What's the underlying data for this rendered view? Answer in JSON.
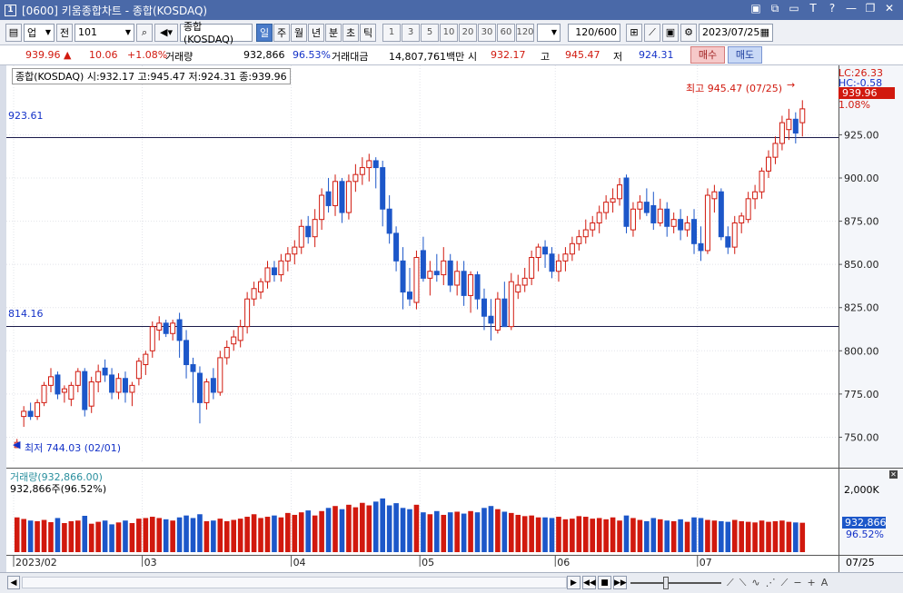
{
  "window": {
    "badge": "1",
    "title": "[0600] 키움종합차트 - 종합(KOSDAQ)",
    "icons": [
      "layout-icon",
      "copy-icon",
      "window-icon",
      "font-icon",
      "help-icon",
      "minimize-icon",
      "restore-icon",
      "close-icon"
    ]
  },
  "toolbar": {
    "market": "업",
    "market2": "전",
    "code": "101",
    "name": "종합(KOSDAQ)",
    "periods": [
      "일",
      "주",
      "월",
      "년",
      "분",
      "초",
      "틱"
    ],
    "selected_period": "일",
    "intervals": [
      "1",
      "3",
      "5",
      "10",
      "20",
      "30",
      "60",
      "120"
    ],
    "count": "120",
    "count_max": "/600",
    "date": "2023/07/25"
  },
  "quote": {
    "price": "939.96",
    "arrow": "▲",
    "change": "10.06",
    "change_pct": "+1.08%",
    "volume_label": "거래량",
    "volume": "932,866",
    "volume_pct": "96.53%",
    "amount_label": "거래대금",
    "amount": "14,807,761백만",
    "open_label": "시",
    "open": "932.17",
    "high_label": "고",
    "high": "945.47",
    "low_label": "저",
    "low": "924.31",
    "buy": "매수",
    "sell": "매도"
  },
  "chart_labels": {
    "price_info": "종합(KOSDAQ) 시:932.17 고:945.47 저:924.31 종:939.96",
    "lc": "LC:26.33",
    "hc": "HC:-0.58",
    "last_price": "939.96",
    "last_pct": "1.08%",
    "high_note": "최고 945.47 (07/25)",
    "low_note": "최저 744.03 (02/01)",
    "line_upper": "923.61",
    "line_lower": "814.16",
    "volume_title": "거래량(932,866.00)",
    "volume_sub": "932,866주(96.52%)",
    "volume_axis_top": "2,000K",
    "volume_last": "932,866",
    "volume_last_pct": "96.52%",
    "x_last": "07/25"
  },
  "colors": {
    "up": "#d1190e",
    "down": "#1c57c9",
    "accent": "#4a69a8"
  },
  "chart_data": {
    "type": "candlestick",
    "ylim": [
      735,
      962
    ],
    "yticks": [
      "925.00",
      "900.00",
      "875.00",
      "850.00",
      "825.00",
      "800.00",
      "775.00",
      "750.00"
    ],
    "ytick_values": [
      925,
      900,
      875,
      850,
      825,
      800,
      775,
      750
    ],
    "h_lines": [
      923.61,
      814.16
    ],
    "months": [
      {
        "label": "2023/02",
        "index": 0
      },
      {
        "label": "03",
        "index": 19
      },
      {
        "label": "04",
        "index": 41
      },
      {
        "label": "05",
        "index": 60
      },
      {
        "label": "06",
        "index": 80
      },
      {
        "label": "07",
        "index": 101
      }
    ],
    "volume_ylim": [
      0,
      2300
    ],
    "ohlc": [
      [
        744,
        749,
        744,
        747
      ],
      [
        762,
        768,
        756,
        765
      ],
      [
        765,
        770,
        760,
        762
      ],
      [
        762,
        772,
        760,
        770
      ],
      [
        770,
        782,
        768,
        780
      ],
      [
        780,
        790,
        776,
        785
      ],
      [
        786,
        788,
        772,
        775
      ],
      [
        776,
        780,
        770,
        778
      ],
      [
        772,
        782,
        768,
        780
      ],
      [
        780,
        790,
        776,
        788
      ],
      [
        788,
        790,
        762,
        766
      ],
      [
        768,
        785,
        764,
        782
      ],
      [
        782,
        792,
        776,
        788
      ],
      [
        790,
        795,
        782,
        786
      ],
      [
        786,
        790,
        772,
        776
      ],
      [
        776,
        787,
        772,
        784
      ],
      [
        784,
        788,
        770,
        776
      ],
      [
        776,
        782,
        768,
        780
      ],
      [
        784,
        796,
        780,
        794
      ],
      [
        792,
        800,
        786,
        798
      ],
      [
        800,
        817,
        796,
        814
      ],
      [
        812,
        820,
        806,
        816
      ],
      [
        816,
        818,
        808,
        810
      ],
      [
        810,
        818,
        806,
        816
      ],
      [
        818,
        822,
        796,
        806
      ],
      [
        806,
        812,
        784,
        792
      ],
      [
        792,
        796,
        770,
        788
      ],
      [
        787,
        791,
        758,
        770
      ],
      [
        770,
        784,
        766,
        782
      ],
      [
        784,
        790,
        772,
        776
      ],
      [
        776,
        800,
        774,
        796
      ],
      [
        796,
        806,
        792,
        802
      ],
      [
        804,
        812,
        800,
        808
      ],
      [
        806,
        818,
        802,
        814
      ],
      [
        814,
        834,
        810,
        830
      ],
      [
        830,
        840,
        826,
        836
      ],
      [
        834,
        842,
        830,
        840
      ],
      [
        840,
        852,
        836,
        848
      ],
      [
        848,
        852,
        840,
        844
      ],
      [
        844,
        856,
        840,
        852
      ],
      [
        852,
        860,
        846,
        856
      ],
      [
        856,
        864,
        850,
        860
      ],
      [
        860,
        876,
        856,
        872
      ],
      [
        872,
        878,
        862,
        866
      ],
      [
        866,
        882,
        860,
        876
      ],
      [
        876,
        894,
        870,
        890
      ],
      [
        892,
        900,
        880,
        884
      ],
      [
        884,
        902,
        878,
        898
      ],
      [
        898,
        900,
        874,
        880
      ],
      [
        880,
        902,
        876,
        898
      ],
      [
        898,
        908,
        892,
        902
      ],
      [
        902,
        912,
        896,
        906
      ],
      [
        906,
        914,
        898,
        910
      ],
      [
        910,
        912,
        894,
        906
      ],
      [
        906,
        910,
        872,
        882
      ],
      [
        882,
        890,
        862,
        868
      ],
      [
        868,
        872,
        846,
        852
      ],
      [
        852,
        860,
        824,
        834
      ],
      [
        834,
        848,
        826,
        830
      ],
      [
        828,
        858,
        824,
        854
      ],
      [
        858,
        866,
        840,
        842
      ],
      [
        842,
        852,
        832,
        846
      ],
      [
        846,
        856,
        840,
        844
      ],
      [
        844,
        860,
        838,
        852
      ],
      [
        852,
        856,
        834,
        838
      ],
      [
        838,
        852,
        832,
        846
      ],
      [
        846,
        852,
        826,
        832
      ],
      [
        832,
        846,
        822,
        844
      ],
      [
        844,
        846,
        824,
        830
      ],
      [
        830,
        836,
        812,
        820
      ],
      [
        820,
        830,
        806,
        816
      ],
      [
        812,
        834,
        810,
        830
      ],
      [
        830,
        840,
        820,
        814
      ],
      [
        814,
        845,
        812,
        840
      ],
      [
        834,
        844,
        830,
        838
      ],
      [
        838,
        848,
        834,
        842
      ],
      [
        842,
        858,
        838,
        854
      ],
      [
        854,
        862,
        846,
        860
      ],
      [
        860,
        864,
        848,
        856
      ],
      [
        856,
        860,
        842,
        846
      ],
      [
        846,
        856,
        840,
        852
      ],
      [
        852,
        860,
        846,
        856
      ],
      [
        856,
        866,
        852,
        862
      ],
      [
        862,
        870,
        858,
        866
      ],
      [
        866,
        876,
        862,
        870
      ],
      [
        870,
        878,
        866,
        874
      ],
      [
        874,
        884,
        868,
        880
      ],
      [
        880,
        890,
        876,
        886
      ],
      [
        886,
        894,
        880,
        888
      ],
      [
        888,
        900,
        884,
        896
      ],
      [
        900,
        902,
        868,
        872
      ],
      [
        870,
        886,
        866,
        882
      ],
      [
        882,
        890,
        876,
        886
      ],
      [
        886,
        894,
        878,
        880
      ],
      [
        884,
        892,
        870,
        874
      ],
      [
        874,
        888,
        872,
        882
      ],
      [
        882,
        886,
        866,
        872
      ],
      [
        872,
        880,
        868,
        876
      ],
      [
        876,
        882,
        864,
        870
      ],
      [
        870,
        878,
        866,
        874
      ],
      [
        876,
        882,
        856,
        862
      ],
      [
        862,
        872,
        852,
        858
      ],
      [
        858,
        894,
        856,
        890
      ],
      [
        888,
        896,
        880,
        892
      ],
      [
        892,
        894,
        864,
        866
      ],
      [
        866,
        872,
        856,
        860
      ],
      [
        860,
        878,
        856,
        874
      ],
      [
        874,
        880,
        868,
        878
      ],
      [
        876,
        892,
        874,
        888
      ],
      [
        888,
        896,
        882,
        892
      ],
      [
        892,
        906,
        888,
        904
      ],
      [
        904,
        916,
        900,
        912
      ],
      [
        912,
        924,
        908,
        920
      ],
      [
        920,
        936,
        916,
        932
      ],
      [
        928,
        940,
        922,
        934
      ],
      [
        934,
        938,
        920,
        926
      ],
      [
        932,
        945,
        924,
        940
      ]
    ],
    "volume": [
      1100,
      1050,
      1000,
      980,
      1020,
      950,
      1080,
      920,
      980,
      1000,
      1150,
      900,
      960,
      1000,
      880,
      940,
      1000,
      920,
      1060,
      1080,
      1120,
      1080,
      1040,
      1000,
      1100,
      1160,
      1080,
      1200,
      980,
      1000,
      1060,
      980,
      1020,
      1060,
      1120,
      1200,
      1080,
      1120,
      1160,
      1100,
      1240,
      1180,
      1260,
      1320,
      1160,
      1300,
      1400,
      1460,
      1360,
      1500,
      1420,
      1560,
      1480,
      1600,
      1700,
      1480,
      1550,
      1400,
      1360,
      1500,
      1260,
      1200,
      1300,
      1180,
      1260,
      1280,
      1220,
      1300,
      1260,
      1400,
      1460,
      1360,
      1280,
      1240,
      1180,
      1140,
      1160,
      1100,
      1100,
      1080,
      1120,
      1040,
      1060,
      1140,
      1120,
      1060,
      1080,
      1040,
      1100,
      1000,
      1160,
      1080,
      1020,
      980,
      1080,
      1040,
      1000,
      980,
      1040,
      960,
      1100,
      1080,
      1020,
      1000,
      980,
      960,
      1020,
      980,
      960,
      940,
      1000,
      960,
      980,
      1000,
      960,
      940,
      930
    ]
  }
}
